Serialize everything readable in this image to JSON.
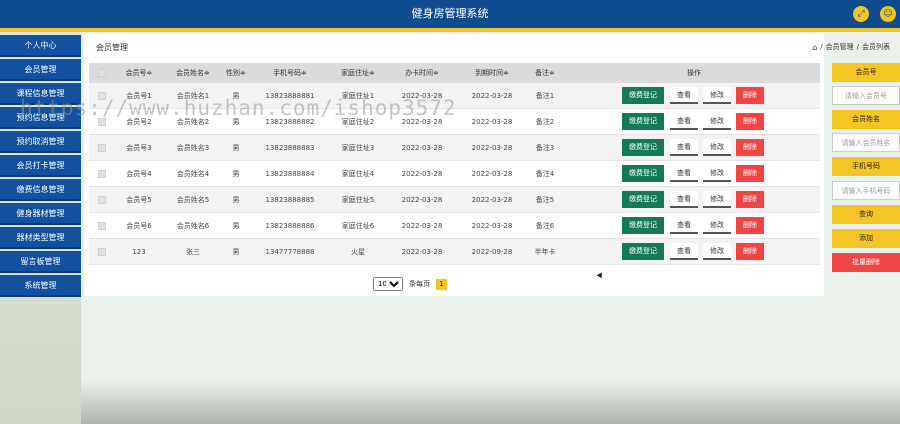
{
  "app": {
    "title": "健身房管理系统"
  },
  "header_icons": [
    "expand-icon",
    "user-icon"
  ],
  "sidebar": {
    "items": [
      {
        "label": "个人中心"
      },
      {
        "label": "会员管理"
      },
      {
        "label": "课程信息管理"
      },
      {
        "label": "预约信息管理"
      },
      {
        "label": "预约取消管理"
      },
      {
        "label": "会员打卡管理"
      },
      {
        "label": "缴费信息管理"
      },
      {
        "label": "健身器材管理"
      },
      {
        "label": "器材类型管理"
      },
      {
        "label": "留言板管理"
      },
      {
        "label": "系统管理"
      }
    ]
  },
  "page": {
    "title": "会员管理",
    "breadcrumb": [
      "会员管理",
      "会员列表"
    ],
    "crumb_sep": "/"
  },
  "table": {
    "headers": [
      "会员号≑",
      "会员姓名≑",
      "性别≑",
      "手机号码≑",
      "家庭住址≑",
      "办卡时间≑",
      "到期时间≑",
      "备注≑",
      "操作"
    ],
    "rows": [
      [
        "会员号1",
        "会员姓名1",
        "男",
        "13823888881",
        "家庭住址1",
        "2022-03-28",
        "2022-03-28",
        "备注1"
      ],
      [
        "会员号2",
        "会员姓名2",
        "男",
        "13823888882",
        "家庭住址2",
        "2022-03-28",
        "2022-03-28",
        "备注2"
      ],
      [
        "会员号3",
        "会员姓名3",
        "男",
        "13823888883",
        "家庭住址3",
        "2022-03-28",
        "2022-03-28",
        "备注3"
      ],
      [
        "会员号4",
        "会员姓名4",
        "男",
        "13823888884",
        "家庭住址4",
        "2022-03-28",
        "2022-03-28",
        "备注4"
      ],
      [
        "会员号5",
        "会员姓名5",
        "男",
        "13823888885",
        "家庭住址5",
        "2022-03-28",
        "2022-03-28",
        "备注5"
      ],
      [
        "会员号6",
        "会员姓名6",
        "男",
        "13823888886",
        "家庭住址6",
        "2022-03-28",
        "2022-03-28",
        "备注6"
      ],
      [
        "123",
        "张三",
        "男",
        "13477778888",
        "火星",
        "2022-03-28",
        "2022-09-28",
        "半年卡"
      ]
    ],
    "actions": {
      "pay": "缴费登记",
      "view": "查看",
      "edit": "修改",
      "delete": "删除"
    }
  },
  "pager": {
    "page_size": "10",
    "per_page_label": "条每页",
    "current_page": "1"
  },
  "right_panel": {
    "member_no_label": "会员号",
    "member_no_placeholder": "请输入会员号",
    "member_name_label": "会员姓名",
    "member_name_placeholder": "请输入会员姓名",
    "phone_label": "手机号码",
    "phone_placeholder": "请输入手机号码",
    "search": "查询",
    "add": "添加",
    "batch_delete": "批量删除"
  },
  "watermark": "https://www.huzhan.com/ishop3572",
  "colors": {
    "header": "#0f4c8f",
    "accent": "#f5c526",
    "pay": "#137a55",
    "danger": "#ef4545"
  }
}
